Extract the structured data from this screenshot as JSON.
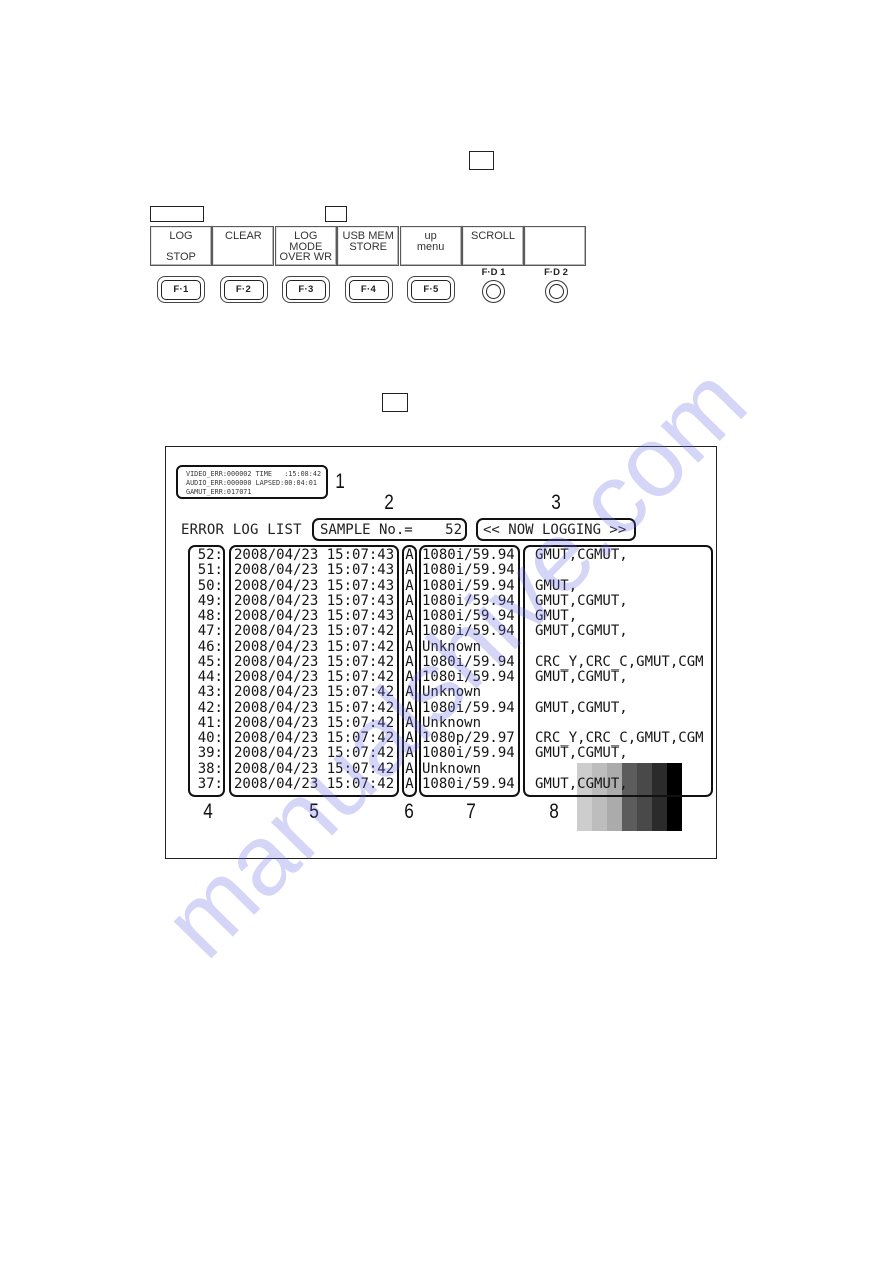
{
  "soft_menu": {
    "buttons": [
      {
        "name": "log-stop",
        "lines": [
          "LOG",
          "",
          "STOP"
        ]
      },
      {
        "name": "clear",
        "lines": [
          "CLEAR"
        ]
      },
      {
        "name": "log-mode",
        "lines": [
          "LOG",
          "MODE",
          "OVER WR"
        ]
      },
      {
        "name": "usb-mem-store",
        "lines": [
          "USB MEM",
          "STORE"
        ]
      },
      {
        "name": "up-menu",
        "lines": [
          "up",
          "menu"
        ]
      },
      {
        "name": "scroll",
        "lines": [
          "SCROLL"
        ]
      },
      {
        "name": "blank",
        "lines": []
      }
    ]
  },
  "keys": [
    {
      "label": "F·1"
    },
    {
      "label": "F·2"
    },
    {
      "label": "F·3"
    },
    {
      "label": "F·4"
    },
    {
      "label": "F·5"
    }
  ],
  "knobs": [
    {
      "label": "F·D 1"
    },
    {
      "label": "F·D 2"
    }
  ],
  "screen": {
    "status": {
      "lines": [
        "VIDEO_ERR:000002 TIME   :15:08:42",
        "AUDIO_ERR:000000 LAPSED:00:04:01",
        "GAMUT_ERR:017071"
      ]
    },
    "title": "ERROR LOG LIST",
    "sample": {
      "label": "SAMPLE No.=",
      "value": "52"
    },
    "logging_status": "<< NOW LOGGING >>",
    "rows": [
      {
        "no": "52:",
        "date": "2008/04/23",
        "time": "15:07:43",
        "mode": "A",
        "format": "1080i/59.94",
        "errors": "GMUT,CGMUT,"
      },
      {
        "no": "51:",
        "date": "2008/04/23",
        "time": "15:07:43",
        "mode": "A",
        "format": "1080i/59.94",
        "errors": ""
      },
      {
        "no": "50:",
        "date": "2008/04/23",
        "time": "15:07:43",
        "mode": "A",
        "format": "1080i/59.94",
        "errors": "GMUT,"
      },
      {
        "no": "49:",
        "date": "2008/04/23",
        "time": "15:07:43",
        "mode": "A",
        "format": "1080i/59.94",
        "errors": "GMUT,CGMUT,"
      },
      {
        "no": "48:",
        "date": "2008/04/23",
        "time": "15:07:43",
        "mode": "A",
        "format": "1080i/59.94",
        "errors": "GMUT,"
      },
      {
        "no": "47:",
        "date": "2008/04/23",
        "time": "15:07:42",
        "mode": "A",
        "format": "1080i/59.94",
        "errors": "GMUT,CGMUT,"
      },
      {
        "no": "46:",
        "date": "2008/04/23",
        "time": "15:07:42",
        "mode": "A",
        "format": "Unknown",
        "errors": ""
      },
      {
        "no": "45:",
        "date": "2008/04/23",
        "time": "15:07:42",
        "mode": "A",
        "format": "1080i/59.94",
        "errors": "CRC_Y,CRC_C,GMUT,CGM"
      },
      {
        "no": "44:",
        "date": "2008/04/23",
        "time": "15:07:42",
        "mode": "A",
        "format": "1080i/59.94",
        "errors": "GMUT,CGMUT,"
      },
      {
        "no": "43:",
        "date": "2008/04/23",
        "time": "15:07:42",
        "mode": "A",
        "format": "Unknown",
        "errors": ""
      },
      {
        "no": "42:",
        "date": "2008/04/23",
        "time": "15:07:42",
        "mode": "A",
        "format": "1080i/59.94",
        "errors": "GMUT,CGMUT,"
      },
      {
        "no": "41:",
        "date": "2008/04/23",
        "time": "15:07:42",
        "mode": "A",
        "format": "Unknown",
        "errors": ""
      },
      {
        "no": "40:",
        "date": "2008/04/23",
        "time": "15:07:42",
        "mode": "A",
        "format": "1080p/29.97",
        "errors": "CRC_Y,CRC_C,GMUT,CGM"
      },
      {
        "no": "39:",
        "date": "2008/04/23",
        "time": "15:07:42",
        "mode": "A",
        "format": "1080i/59.94",
        "errors": "GMUT,CGMUT,"
      },
      {
        "no": "38:",
        "date": "2008/04/23",
        "time": "15:07:42",
        "mode": "A",
        "format": "Unknown",
        "errors": ""
      },
      {
        "no": "37:",
        "date": "2008/04/23",
        "time": "15:07:42",
        "mode": "A",
        "format": "1080i/59.94",
        "errors": "GMUT,CGMUT,"
      }
    ],
    "grayscale": [
      "#cdcdcd",
      "#bdbdbd",
      "#ababab",
      "#5c5c5c",
      "#494949",
      "#2b2b2b",
      "#000000"
    ]
  },
  "callouts": [
    "1",
    "2",
    "3",
    "4",
    "5",
    "6",
    "7",
    "8"
  ],
  "watermark": "manualshive.com"
}
